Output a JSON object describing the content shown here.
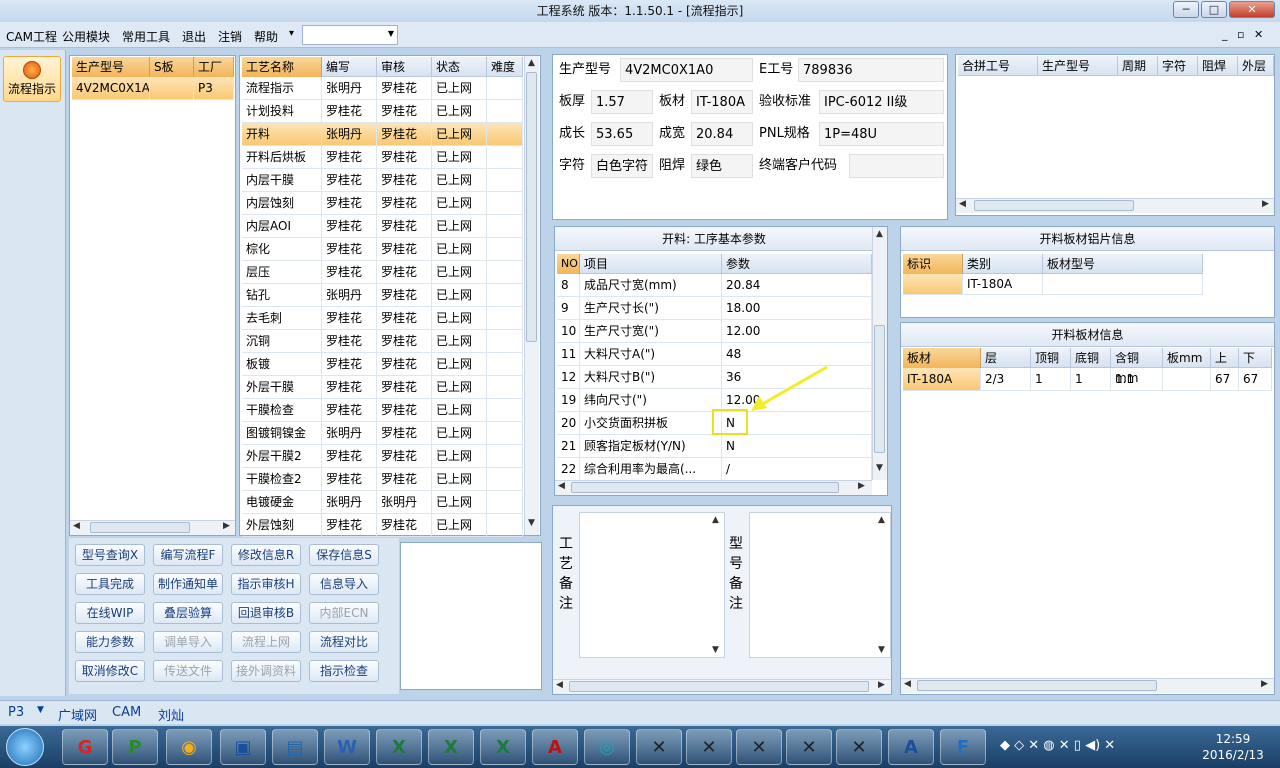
{
  "window": {
    "title": "工程系统  版本：1.1.50.1 - [流程指示]",
    "min": "─",
    "max": "□",
    "close": "✕"
  },
  "menu": {
    "items": [
      "CAM工程",
      "公用模块",
      "常用工具",
      "退出",
      "注销",
      "帮助"
    ],
    "help_arrow": "▾",
    "combo_value": "",
    "mdi_controls": "_ ▫ ✕"
  },
  "sidebar": {
    "button_label": "流程指示"
  },
  "model_list": {
    "headers": [
      "生产型号",
      "S板",
      "工厂"
    ],
    "rows": [
      [
        "4V2MC0X1A0",
        "",
        "P3"
      ]
    ]
  },
  "process_list": {
    "headers": [
      "工艺名称",
      "编写",
      "审核",
      "状态",
      "难度"
    ],
    "rows": [
      [
        "流程指示",
        "张明丹",
        "罗桂花",
        "已上网",
        ""
      ],
      [
        "计划投料",
        "罗桂花",
        "罗桂花",
        "已上网",
        ""
      ],
      [
        "开料",
        "张明丹",
        "罗桂花",
        "已上网",
        ""
      ],
      [
        "开料后烘板",
        "罗桂花",
        "罗桂花",
        "已上网",
        ""
      ],
      [
        "内层干膜",
        "罗桂花",
        "罗桂花",
        "已上网",
        ""
      ],
      [
        "内层蚀刻",
        "罗桂花",
        "罗桂花",
        "已上网",
        ""
      ],
      [
        "内层AOI",
        "罗桂花",
        "罗桂花",
        "已上网",
        ""
      ],
      [
        "棕化",
        "罗桂花",
        "罗桂花",
        "已上网",
        ""
      ],
      [
        "层压",
        "罗桂花",
        "罗桂花",
        "已上网",
        ""
      ],
      [
        "钻孔",
        "张明丹",
        "罗桂花",
        "已上网",
        ""
      ],
      [
        "去毛刺",
        "罗桂花",
        "罗桂花",
        "已上网",
        ""
      ],
      [
        "沉铜",
        "罗桂花",
        "罗桂花",
        "已上网",
        ""
      ],
      [
        "板镀",
        "罗桂花",
        "罗桂花",
        "已上网",
        ""
      ],
      [
        "外层干膜",
        "罗桂花",
        "罗桂花",
        "已上网",
        ""
      ],
      [
        "干膜检查",
        "罗桂花",
        "罗桂花",
        "已上网",
        ""
      ],
      [
        "图镀铜镍金",
        "张明丹",
        "罗桂花",
        "已上网",
        ""
      ],
      [
        "外层干膜2",
        "罗桂花",
        "罗桂花",
        "已上网",
        ""
      ],
      [
        "干膜检查2",
        "罗桂花",
        "罗桂花",
        "已上网",
        ""
      ],
      [
        "电镀硬金",
        "张明丹",
        "张明丹",
        "已上网",
        ""
      ],
      [
        "外层蚀刻",
        "罗桂花",
        "罗桂花",
        "已上网",
        ""
      ]
    ],
    "selected_index": 2
  },
  "actions": [
    [
      "型号查询X",
      "编写流程F",
      "修改信息R",
      "保存信息S"
    ],
    [
      "工具完成",
      "制作通知单",
      "指示审核H",
      "信息导入"
    ],
    [
      "在线WIP",
      "叠层验算",
      "回退审核B",
      "内部ECN"
    ],
    [
      "能力参数",
      "调单导入",
      "流程上网",
      "流程对比"
    ],
    [
      "取消修改C",
      "传送文件",
      "接外调资料",
      "指示检查"
    ]
  ],
  "actions_disabled": [
    "内部ECN",
    "调单导入",
    "流程上网",
    "传送文件",
    "接外调资料"
  ],
  "info": {
    "prod_model_label": "生产型号",
    "prod_model": "4V2MC0X1A0",
    "e_no_label": "E工号",
    "e_no": "789836",
    "thickness_label": "板厚",
    "thickness": "1.57",
    "material_label": "板材",
    "material": "IT-180A",
    "standard_label": "验收标准",
    "standard": "IPC-6012 II级",
    "len_label": "成长",
    "len": "53.65",
    "width_label": "成宽",
    "width": "20.84",
    "pnl_label": "PNL规格",
    "pnl": "1P=48U",
    "char_label": "字符",
    "char": "白色字符",
    "mask_label": "阻焊",
    "mask": "绿色",
    "customer_label": "终端客户代码",
    "customer": ""
  },
  "merge_table": {
    "headers": [
      "合拼工号",
      "生产型号",
      "周期",
      "字符",
      "阻焊",
      "外层"
    ]
  },
  "params": {
    "title": "开料: 工序基本参数",
    "headers": [
      "NO",
      "项目",
      "参数"
    ],
    "rows": [
      [
        "8",
        "成品尺寸宽(mm)",
        "20.84"
      ],
      [
        "9",
        "生产尺寸长(\")",
        "18.00"
      ],
      [
        "10",
        "生产尺寸宽(\")",
        "12.00"
      ],
      [
        "11",
        "大料尺寸A(\")",
        "48"
      ],
      [
        "12",
        "大料尺寸B(\")",
        "36"
      ],
      [
        "19",
        "纬向尺寸(\")",
        "12.00"
      ],
      [
        "20",
        "小交货面积拼板",
        "N"
      ],
      [
        "21",
        "顾客指定板材(Y/N)",
        "N"
      ],
      [
        "22",
        "综合利用率为最高(...",
        "/"
      ]
    ]
  },
  "remarks": {
    "process_label": "工艺备注",
    "model_label": "型号备注"
  },
  "alu_info": {
    "title": "开料板材铝片信息",
    "headers": [
      "标识",
      "类别",
      "板材型号"
    ],
    "rows": [
      [
        "",
        "IT-180A",
        ""
      ]
    ]
  },
  "board_info": {
    "title": "开料板材信息",
    "headers": [
      "板材",
      "层",
      "顶铜",
      "底铜",
      "含铜mm",
      "板mm",
      "上",
      "下"
    ],
    "rows": [
      [
        "IT-180A",
        "2/3",
        "1",
        "1",
        "1.1",
        "",
        "67",
        "67"
      ]
    ]
  },
  "status": {
    "factory": "P3",
    "items": [
      "广域网",
      "CAM",
      "刘灿"
    ]
  },
  "taskbar": {
    "time": "12:59",
    "date": "2016/2/13"
  }
}
